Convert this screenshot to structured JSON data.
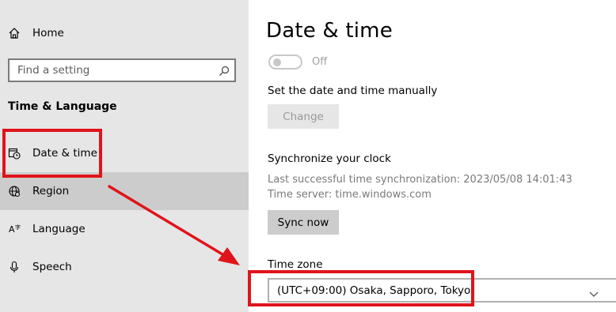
{
  "sidebar": {
    "home_label": "Home",
    "search_placeholder": "Find a setting",
    "section_title": "Time & Language",
    "items": [
      {
        "label": "Date & time",
        "icon": "calendar-clock-icon"
      },
      {
        "label": "Region",
        "icon": "globe-icon"
      },
      {
        "label": "Language",
        "icon": "language-icon"
      },
      {
        "label": "Speech",
        "icon": "microphone-icon"
      }
    ]
  },
  "main": {
    "title": "Date & time",
    "auto_time_toggle": {
      "state_label": "Off",
      "on": false
    },
    "manual": {
      "label": "Set the date and time manually",
      "button": "Change"
    },
    "sync": {
      "heading": "Synchronize your clock",
      "last_sync": "Last successful time synchronization: 2023/05/08 14:01:43",
      "server": "Time server: time.windows.com",
      "button": "Sync now"
    },
    "timezone": {
      "label": "Time zone",
      "value": "(UTC+09:00) Osaka, Sapporo, Tokyo"
    }
  },
  "colors": {
    "sidebar_bg": "#e6e6e6",
    "hover_bg": "#cccccc",
    "annotation_red": "#e0141b"
  }
}
